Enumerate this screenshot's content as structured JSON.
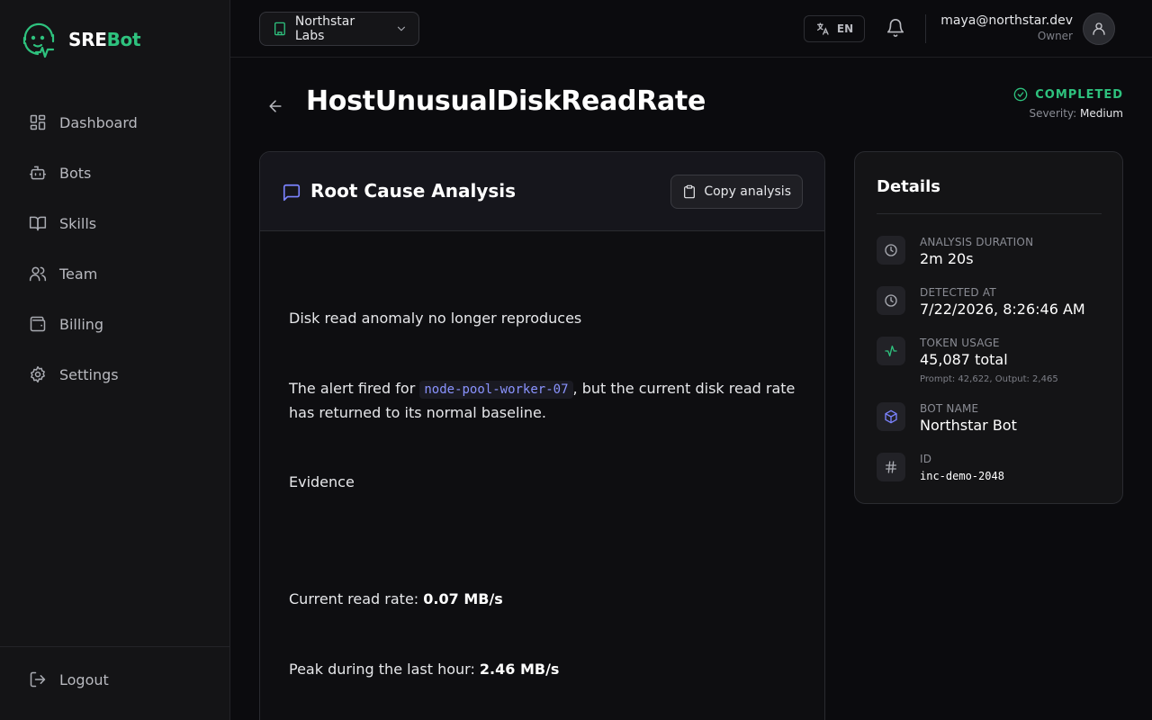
{
  "brand": {
    "prefix": "SRE",
    "suffix": "Bot",
    "accent_color": "#2ec27e"
  },
  "sidebar": {
    "items": [
      {
        "label": "Dashboard",
        "icon": "layout-grid-icon"
      },
      {
        "label": "Bots",
        "icon": "bot-icon"
      },
      {
        "label": "Skills",
        "icon": "book-open-icon"
      },
      {
        "label": "Team",
        "icon": "users-icon"
      },
      {
        "label": "Billing",
        "icon": "wallet-icon"
      },
      {
        "label": "Settings",
        "icon": "gear-icon"
      }
    ],
    "logout_label": "Logout"
  },
  "header": {
    "org_name": "Northstar Labs",
    "language": "EN",
    "user_email": "maya@northstar.dev",
    "user_role": "Owner"
  },
  "incident": {
    "title": "HostUnusualDiskReadRate",
    "status": "COMPLETED",
    "severity_label": "Severity:",
    "severity": "Medium"
  },
  "rca": {
    "title": "Root Cause Analysis",
    "copy_label": "Copy analysis",
    "heading": "Disk read anomaly no longer reproduces",
    "para_prefix": "The alert fired for ",
    "para_code": "node-pool-worker-07",
    "para_suffix": ", but the current disk read rate has returned to its normal baseline.",
    "evidence_label": "Evidence",
    "current_rate_label": "Current read rate: ",
    "current_rate_value": "0.07 MB/s",
    "peak_label": "Peak during the last hour: ",
    "peak_value": "2.46 MB/s"
  },
  "details": {
    "title": "Details",
    "duration_label": "ANALYSIS DURATION",
    "duration_value": "2m 20s",
    "detected_label": "DETECTED AT",
    "detected_value": "7/22/2026, 8:26:46 AM",
    "tokens_label": "TOKEN USAGE",
    "tokens_value": "45,087 total",
    "tokens_sub": "Prompt: 42,622, Output: 2,465",
    "bot_label": "BOT NAME",
    "bot_value": "Northstar Bot",
    "id_label": "ID",
    "id_value": "inc-demo-2048"
  }
}
